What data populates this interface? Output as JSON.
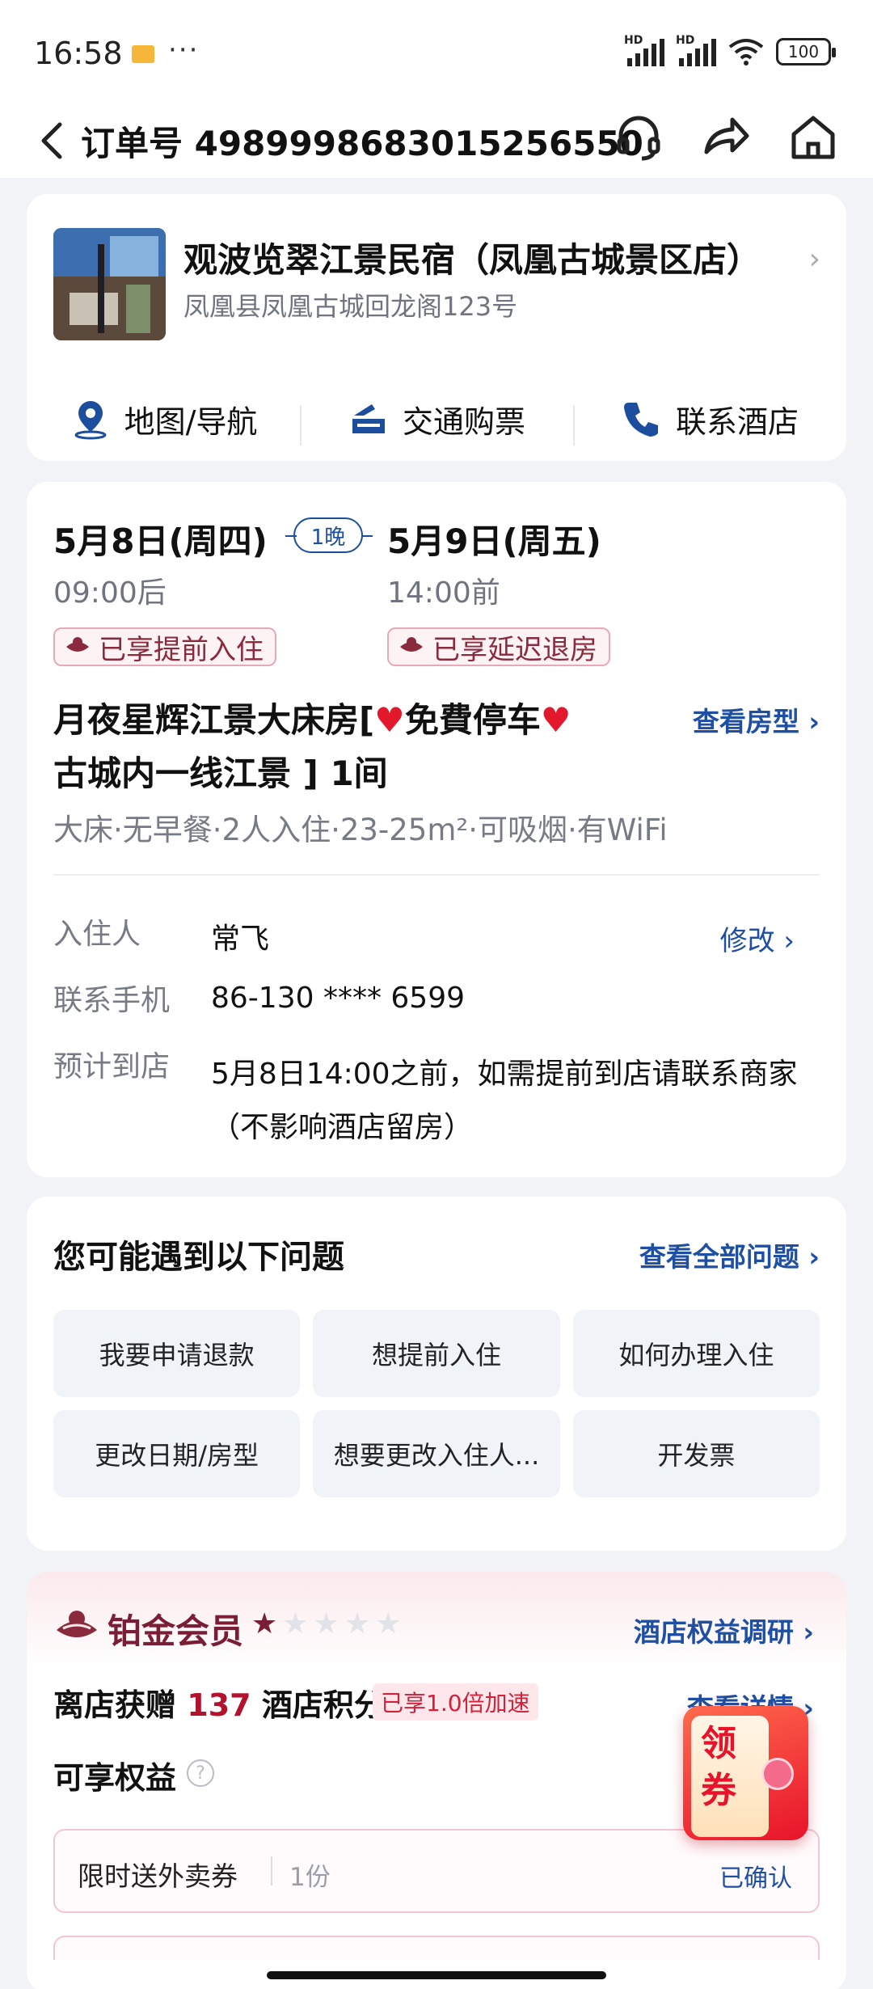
{
  "status_bar": {
    "time": "16:58",
    "dots": "···",
    "network_1": "HD",
    "network_2": "HD",
    "battery": "100"
  },
  "nav": {
    "title_prefix": "订单号",
    "order_number": "4989998683015256550",
    "icons": [
      "back-icon",
      "headset-icon",
      "share-icon",
      "home-icon"
    ]
  },
  "hotel": {
    "name": "观波览翠江景民宿（凤凰古城景区店）",
    "address": "凤凰县凤凰古城回龙阁123号",
    "actions": [
      {
        "label": "地图/导航",
        "icon": "map-pin-icon"
      },
      {
        "label": "交通购票",
        "icon": "transport-icon"
      },
      {
        "label": "联系酒店",
        "icon": "phone-icon"
      }
    ]
  },
  "stay": {
    "checkin_date": "5月8日(周四)",
    "checkin_time": "09:00后",
    "nights": "1晚",
    "checkout_date": "5月9日(周五)",
    "checkout_time": "14:00前",
    "perk_checkin": "已享提前入住",
    "perk_checkout": "已享延迟退房",
    "room_title_a": "月夜星辉江景大床房[",
    "room_title_heart": "♥",
    "room_title_b": "免費停车",
    "room_title_c": "古城内一线江景 ] 1间",
    "room_link": "查看房型 ›",
    "room_features": "大床·无早餐·2人入住·23-25m²·可吸烟·有WiFi",
    "guest_label": "入住人",
    "guest_value": "常飞",
    "edit_link": "修改 ›",
    "phone_label": "联系手机",
    "phone_value": "86-130 **** 6599",
    "arrival_label": "预计到店",
    "arrival_value": "5月8日14:00之前，如需提前到店请联系商家（不影响酒店留房）"
  },
  "questions": {
    "title": "您可能遇到以下问题",
    "all_link": "查看全部问题 ›",
    "items": [
      "我要申请退款",
      "想提前入住",
      "如何办理入住",
      "更改日期/房型",
      "想要更改入住人...",
      "开发票"
    ]
  },
  "member": {
    "title": "铂金会员",
    "stars_filled": "★",
    "stars_empty": "★★★★",
    "survey_link": "酒店权益调研 ›",
    "points_prefix": "离店获赠",
    "points_value": "137",
    "points_suffix": "酒店积分",
    "speed_badge": "已享1.0倍加速",
    "detail_link": "查看详情 ›",
    "rights_label": "可享权益",
    "help": "?",
    "coupon_label": "限时送外卖券",
    "coupon_qty": "1份",
    "coupon_status": "已确认"
  },
  "floating": {
    "label": "领券"
  },
  "colors": {
    "accent_blue": "#1f4fa3",
    "member_red": "#7a1e35",
    "heart_red": "#e3182d"
  }
}
